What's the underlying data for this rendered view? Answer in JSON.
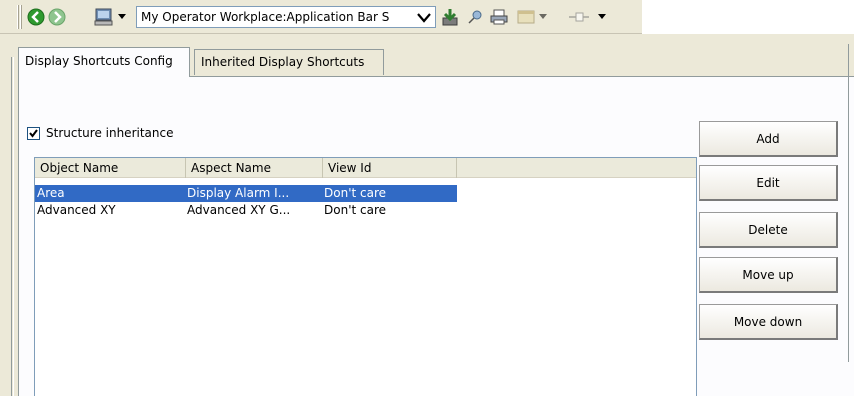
{
  "toolbar": {
    "back_icon": "back-arrow-icon",
    "forward_icon": "forward-arrow-icon",
    "workplace_icon": "computer-icon",
    "workplace_selector_value": "My Operator Workplace:Application Bar S",
    "colors": {
      "back": "#2f9a2f",
      "forward": "#8fc58f"
    }
  },
  "tabs": [
    {
      "label": "Display Shortcuts Config",
      "active": true
    },
    {
      "label": "Inherited Display Shortcuts",
      "active": false
    }
  ],
  "structure_inheritance": {
    "label": "Structure inheritance",
    "checked": true
  },
  "list": {
    "columns": [
      "Object Name",
      "Aspect Name",
      "View Id"
    ],
    "rows": [
      {
        "object_name": "Area",
        "aspect_name": "Display Alarm I...",
        "view_id": "Don't care",
        "selected": true
      },
      {
        "object_name": "Advanced XY",
        "aspect_name": "Advanced XY G...",
        "view_id": "Don't care",
        "selected": false
      }
    ]
  },
  "buttons": {
    "add": "Add",
    "edit": "Edit",
    "delete": "Delete",
    "move_up": "Move up",
    "move_down": "Move down"
  },
  "colors": {
    "selection": "#316ac5",
    "panel_bg": "#ece9d8"
  }
}
